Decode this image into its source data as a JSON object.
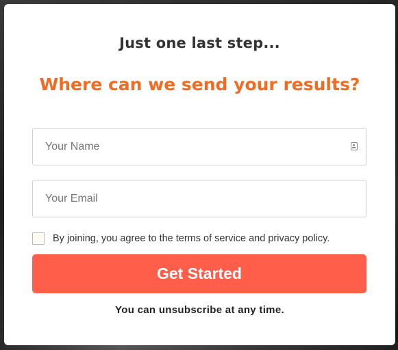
{
  "modal": {
    "subtitle": "Just one last step...",
    "title": "Where can we send your results?",
    "name_field": {
      "placeholder": "Your Name",
      "value": ""
    },
    "email_field": {
      "placeholder": "Your Email",
      "value": ""
    },
    "agreement": {
      "checked": false,
      "label": "By joining, you agree to the terms of service and privacy policy."
    },
    "submit_label": "Get Started",
    "footnote": "You can unsubscribe at any time."
  },
  "colors": {
    "title_accent": "#f26b22",
    "button_bg": "#ff5f4a",
    "modal_bg": "#ffffff"
  },
  "icons": {
    "name_field_icon": "contact-card-icon"
  }
}
